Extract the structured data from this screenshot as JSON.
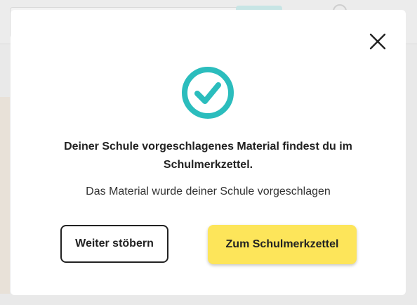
{
  "modal": {
    "headline": "Deiner Schule vorgeschlagenes Material findest du im Schulmerkzettel.",
    "subline": "Das Material wurde deiner Schule vorgeschlagen",
    "secondary_button_label": "Weiter stöbern",
    "primary_button_label": "Zum Schulmerkzettel",
    "icons": {
      "success": "check-circle-icon",
      "close": "close-icon"
    }
  },
  "colors": {
    "accent_teal": "#2bbdbd",
    "primary_button": "#fde55a",
    "overlay": "#e9e9e9",
    "text": "#222222"
  }
}
